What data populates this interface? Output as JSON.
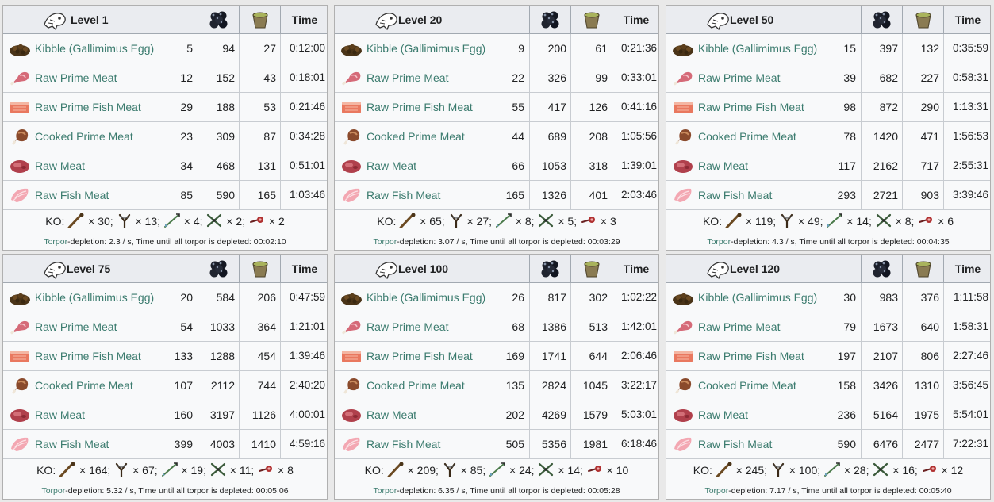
{
  "headers": {
    "time": "Time",
    "berry_icon": "narcoberry-icon",
    "narc_icon": "narcotic-icon"
  },
  "ko_label": "KO",
  "torpor": {
    "link": "Torpor",
    "mid": "-depletion: ",
    "unit": " / s",
    "tail": ", Time until all torpor is depleted: "
  },
  "foods": [
    {
      "name": "Kibble (Gallimimus Egg)",
      "icon": "kibble-icon"
    },
    {
      "name": "Raw Prime Meat",
      "icon": "raw-prime-meat-icon"
    },
    {
      "name": "Raw Prime Fish Meat",
      "icon": "raw-prime-fish-meat-icon"
    },
    {
      "name": "Cooked Prime Meat",
      "icon": "cooked-prime-meat-icon"
    },
    {
      "name": "Raw Meat",
      "icon": "raw-meat-icon"
    },
    {
      "name": "Raw Fish Meat",
      "icon": "raw-fish-meat-icon"
    }
  ],
  "ko_weapons": [
    "club-icon",
    "slingshot-icon",
    "tranq-arrow-icon",
    "tranq-dart-icon",
    "shocking-dart-icon"
  ],
  "panels": [
    {
      "level": "Level 1",
      "rows": [
        {
          "qty": "5",
          "berry": "94",
          "narc": "27",
          "time": "0:12:00"
        },
        {
          "qty": "12",
          "berry": "152",
          "narc": "43",
          "time": "0:18:01"
        },
        {
          "qty": "29",
          "berry": "188",
          "narc": "53",
          "time": "0:21:46"
        },
        {
          "qty": "23",
          "berry": "309",
          "narc": "87",
          "time": "0:34:28"
        },
        {
          "qty": "34",
          "berry": "468",
          "narc": "131",
          "time": "0:51:01"
        },
        {
          "qty": "85",
          "berry": "590",
          "narc": "165",
          "time": "1:03:46"
        }
      ],
      "ko": [
        "30",
        "13",
        "4",
        "2",
        "2"
      ],
      "rate": "2.3",
      "depleted": "00:02:10"
    },
    {
      "level": "Level 20",
      "rows": [
        {
          "qty": "9",
          "berry": "200",
          "narc": "61",
          "time": "0:21:36"
        },
        {
          "qty": "22",
          "berry": "326",
          "narc": "99",
          "time": "0:33:01"
        },
        {
          "qty": "55",
          "berry": "417",
          "narc": "126",
          "time": "0:41:16"
        },
        {
          "qty": "44",
          "berry": "689",
          "narc": "208",
          "time": "1:05:56"
        },
        {
          "qty": "66",
          "berry": "1053",
          "narc": "318",
          "time": "1:39:01"
        },
        {
          "qty": "165",
          "berry": "1326",
          "narc": "401",
          "time": "2:03:46"
        }
      ],
      "ko": [
        "65",
        "27",
        "8",
        "5",
        "3"
      ],
      "rate": "3.07",
      "depleted": "00:03:29"
    },
    {
      "level": "Level 50",
      "rows": [
        {
          "qty": "15",
          "berry": "397",
          "narc": "132",
          "time": "0:35:59"
        },
        {
          "qty": "39",
          "berry": "682",
          "narc": "227",
          "time": "0:58:31"
        },
        {
          "qty": "98",
          "berry": "872",
          "narc": "290",
          "time": "1:13:31"
        },
        {
          "qty": "78",
          "berry": "1420",
          "narc": "471",
          "time": "1:56:53"
        },
        {
          "qty": "117",
          "berry": "2162",
          "narc": "717",
          "time": "2:55:31"
        },
        {
          "qty": "293",
          "berry": "2721",
          "narc": "903",
          "time": "3:39:46"
        }
      ],
      "ko": [
        "119",
        "49",
        "14",
        "8",
        "6"
      ],
      "rate": "4.3",
      "depleted": "00:04:35"
    },
    {
      "level": "Level 75",
      "rows": [
        {
          "qty": "20",
          "berry": "584",
          "narc": "206",
          "time": "0:47:59"
        },
        {
          "qty": "54",
          "berry": "1033",
          "narc": "364",
          "time": "1:21:01"
        },
        {
          "qty": "133",
          "berry": "1288",
          "narc": "454",
          "time": "1:39:46"
        },
        {
          "qty": "107",
          "berry": "2112",
          "narc": "744",
          "time": "2:40:20"
        },
        {
          "qty": "160",
          "berry": "3197",
          "narc": "1126",
          "time": "4:00:01"
        },
        {
          "qty": "399",
          "berry": "4003",
          "narc": "1410",
          "time": "4:59:16"
        }
      ],
      "ko": [
        "164",
        "67",
        "19",
        "11",
        "8"
      ],
      "rate": "5.32",
      "depleted": "00:05:06"
    },
    {
      "level": "Level 100",
      "rows": [
        {
          "qty": "26",
          "berry": "817",
          "narc": "302",
          "time": "1:02:22"
        },
        {
          "qty": "68",
          "berry": "1386",
          "narc": "513",
          "time": "1:42:01"
        },
        {
          "qty": "169",
          "berry": "1741",
          "narc": "644",
          "time": "2:06:46"
        },
        {
          "qty": "135",
          "berry": "2824",
          "narc": "1045",
          "time": "3:22:17"
        },
        {
          "qty": "202",
          "berry": "4269",
          "narc": "1579",
          "time": "5:03:01"
        },
        {
          "qty": "505",
          "berry": "5356",
          "narc": "1981",
          "time": "6:18:46"
        }
      ],
      "ko": [
        "209",
        "85",
        "24",
        "14",
        "10"
      ],
      "rate": "6.35",
      "depleted": "00:05:28"
    },
    {
      "level": "Level 120",
      "rows": [
        {
          "qty": "30",
          "berry": "983",
          "narc": "376",
          "time": "1:11:58"
        },
        {
          "qty": "79",
          "berry": "1673",
          "narc": "640",
          "time": "1:58:31"
        },
        {
          "qty": "197",
          "berry": "2107",
          "narc": "806",
          "time": "2:27:46"
        },
        {
          "qty": "158",
          "berry": "3426",
          "narc": "1310",
          "time": "3:56:45"
        },
        {
          "qty": "236",
          "berry": "5164",
          "narc": "1975",
          "time": "5:54:01"
        },
        {
          "qty": "590",
          "berry": "6476",
          "narc": "2477",
          "time": "7:22:31"
        }
      ],
      "ko": [
        "245",
        "100",
        "28",
        "16",
        "12"
      ],
      "rate": "7.17",
      "depleted": "00:05:40"
    }
  ]
}
